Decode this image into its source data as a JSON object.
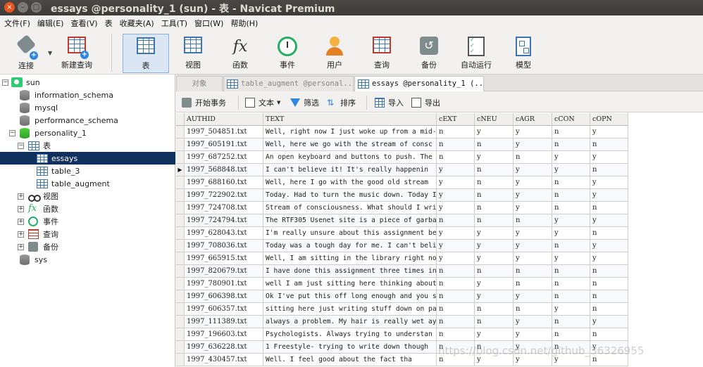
{
  "window": {
    "title": "essays @personality_1 (sun) - 表 - Navicat Premium",
    "close_glyph": "×",
    "min_glyph": "–",
    "max_glyph": "□"
  },
  "menu": [
    "文件(F)",
    "编辑(E)",
    "查看(V)",
    "表",
    "收藏夹(A)",
    "工具(T)",
    "窗口(W)",
    "帮助(H)"
  ],
  "toolbar": {
    "connect": "连接",
    "new_query": "新建查询",
    "table": "表",
    "view": "视图",
    "function": "函数",
    "event": "事件",
    "user": "用户",
    "query": "查询",
    "backup": "备份",
    "autorun": "自动运行",
    "model": "模型",
    "fx_glyph": "fx"
  },
  "tree": {
    "connection": "sun",
    "dbs": [
      "information_schema",
      "mysql",
      "performance_schema",
      "personality_1",
      "sys"
    ],
    "tables_node": "表",
    "tables": [
      "essays",
      "table_3",
      "table_augment"
    ],
    "views": "视图",
    "functions": "函数",
    "events": "事件",
    "queries": "查询",
    "backups": "备份",
    "fx_glyph": "fx",
    "plus": "+",
    "minus": "−"
  },
  "tabs": {
    "objects": "对象",
    "tab2": "table_augment @personal...",
    "tab3": "essays @personality_1 (..."
  },
  "subtoolbar": {
    "begin_tx": "开始事务",
    "text": "文本",
    "filter": "筛选",
    "sort": "排序",
    "import": "导入",
    "export": "导出"
  },
  "grid": {
    "columns": [
      "AUTHID",
      "TEXT",
      "cEXT",
      "cNEU",
      "cAGR",
      "cCON",
      "cOPN"
    ],
    "current_row_marker": "▶",
    "rows": [
      [
        "1997_504851.txt",
        "Well, right now I just woke up from a mid-",
        "n",
        "y",
        "y",
        "n",
        "y"
      ],
      [
        "1997_605191.txt",
        "Well, here we go with the stream of consc",
        "n",
        "n",
        "y",
        "n",
        "n"
      ],
      [
        "1997_687252.txt",
        "An open keyboard and buttons to push. The",
        "n",
        "y",
        "n",
        "y",
        "y"
      ],
      [
        "1997_568848.txt",
        "I can't believe it!  It's really happenin",
        "y",
        "n",
        "y",
        "y",
        "n"
      ],
      [
        "1997_688160.txt",
        "Well, here I go with the good old stream ",
        "y",
        "n",
        "y",
        "n",
        "y"
      ],
      [
        "1997_722902.txt",
        "Today. Had to turn the music down. Today I",
        "y",
        "n",
        "y",
        "n",
        "y"
      ],
      [
        "1997_724708.txt",
        "Stream of consciousness. What should I wri",
        "y",
        "n",
        "y",
        "n",
        "n"
      ],
      [
        "1997_724794.txt",
        "The RTF305 Usenet site is a piece of garba",
        "n",
        "n",
        "n",
        "y",
        "y"
      ],
      [
        "1997_628043.txt",
        "I'm really unsure about this assignment be",
        "y",
        "y",
        "y",
        "y",
        "n"
      ],
      [
        "1997_708036.txt",
        "Today was a tough day for me. I can't beli",
        "y",
        "y",
        "y",
        "n",
        "y"
      ],
      [
        "1997_665915.txt",
        "Well, I am sitting in the library right no",
        "y",
        "y",
        "y",
        "y",
        "y"
      ],
      [
        "1997_820679.txt",
        "I have done this assignment three times in",
        "n",
        "n",
        "n",
        "n",
        "n"
      ],
      [
        "1997_780901.txt",
        "well I am just sitting here thinking about",
        "n",
        "y",
        "n",
        "n",
        "n"
      ],
      [
        "1997_606398.txt",
        "Ok I've put this off long enough and you s",
        "n",
        "y",
        "y",
        "n",
        "n"
      ],
      [
        "1997_606357.txt",
        "sitting here just writing stuff down on pa",
        "n",
        "n",
        "n",
        "y",
        "n"
      ],
      [
        "1997_111389.txt",
        "always a problem. My hair is really wet ay",
        "n",
        "n",
        "y",
        "n",
        "y"
      ],
      [
        "1997_196603.txt",
        "Psychologists. Always trying to understan",
        "n",
        "y",
        "y",
        "n",
        "n"
      ],
      [
        "1997_636228.txt",
        "1   Freestyle- trying to write down though",
        "n",
        "n",
        "y",
        "n",
        "y"
      ],
      [
        "1997_430457.txt",
        "     Well. I feel good about the fact tha",
        "n",
        "y",
        "y",
        "y",
        "n"
      ]
    ]
  },
  "watermark": "https://blog.csdn.net/github_36326955"
}
